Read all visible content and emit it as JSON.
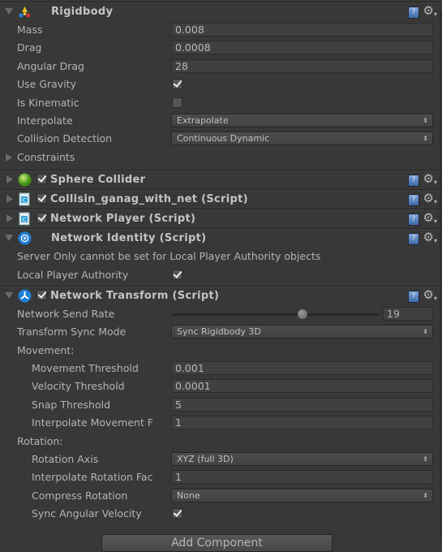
{
  "components": [
    {
      "title": "Rigidbody",
      "icon": "rigidbody-icon",
      "expanded": true,
      "has_toggle": false,
      "rows": [
        {
          "label": "Mass",
          "type": "float",
          "value": "0.008"
        },
        {
          "label": "Drag",
          "type": "float",
          "value": "0.0008"
        },
        {
          "label": "Angular Drag",
          "type": "float",
          "value": "28"
        },
        {
          "label": "Use Gravity",
          "type": "check",
          "checked": true
        },
        {
          "label": "Is Kinematic",
          "type": "check",
          "checked": false
        },
        {
          "label": "Interpolate",
          "type": "enum",
          "value": "Extrapolate"
        },
        {
          "label": "Collision Detection",
          "type": "enum",
          "value": "Continuous Dynamic"
        },
        {
          "label": "Constraints",
          "type": "foldout"
        }
      ]
    },
    {
      "title": "Sphere Collider",
      "icon": "sphere-collider-icon",
      "expanded": false,
      "has_toggle": true,
      "enabled": true,
      "rows": []
    },
    {
      "title": "Collisin_ganag_with_net (Script)",
      "icon": "csharp-script-icon",
      "expanded": false,
      "has_toggle": true,
      "enabled": true,
      "rows": []
    },
    {
      "title": "Network Player (Script)",
      "icon": "csharp-script-icon",
      "expanded": false,
      "has_toggle": true,
      "enabled": true,
      "rows": []
    },
    {
      "title": "Network Identity (Script)",
      "icon": "network-identity-icon",
      "expanded": true,
      "has_toggle": false,
      "rows": [
        {
          "label": "Server Only cannot be set for Local Player Authority objects",
          "type": "text"
        },
        {
          "label": "Local Player Authority",
          "type": "check",
          "checked": true
        }
      ]
    },
    {
      "title": "Network Transform (Script)",
      "icon": "network-transform-icon",
      "expanded": true,
      "has_toggle": true,
      "enabled": true,
      "rows": [
        {
          "label": "Network Send Rate",
          "type": "slider",
          "value": "19",
          "min": 0,
          "max": 30
        },
        {
          "label": "Transform Sync Mode",
          "type": "enum",
          "value": "Sync Rigidbody 3D"
        },
        {
          "label": "Movement:",
          "type": "text"
        },
        {
          "label": "Movement Threshold",
          "type": "float",
          "value": "0.001",
          "indent": true
        },
        {
          "label": "Velocity Threshold",
          "type": "float",
          "value": "0.0001",
          "indent": true
        },
        {
          "label": "Snap Threshold",
          "type": "float",
          "value": "5",
          "indent": true
        },
        {
          "label": "Interpolate Movement F",
          "type": "float",
          "value": "1",
          "indent": true
        },
        {
          "label": "Rotation:",
          "type": "text"
        },
        {
          "label": "Rotation Axis",
          "type": "enum",
          "value": "XYZ (full 3D)",
          "indent": true
        },
        {
          "label": "Interpolate Rotation Fac",
          "type": "float",
          "value": "1",
          "indent": true
        },
        {
          "label": "Compress Rotation",
          "type": "enum",
          "value": "None",
          "indent": true
        },
        {
          "label": "Sync Angular Velocity",
          "type": "check",
          "checked": true,
          "indent": true
        }
      ]
    }
  ],
  "common": {
    "help_glyph": "?",
    "gear_glyph": "⚙",
    "gear_caret": "▾",
    "enum_arrow": "⬍"
  },
  "add_component_label": "Add Component",
  "colors": {
    "background": "#383838",
    "text": "#b4b4b4",
    "help_blue": "#4a7ab8",
    "sphere_green": "#5fbf1f",
    "network_blue": "#1e7fd6"
  }
}
